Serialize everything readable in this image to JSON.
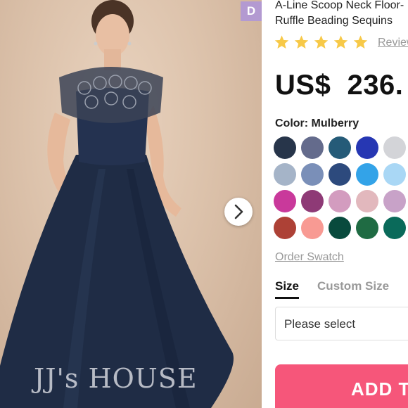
{
  "badge": {
    "letter": "D",
    "color": "#b39ad1"
  },
  "photo": {
    "watermark": "JJ's HOUSE",
    "next_icon": "chevron-right-icon"
  },
  "product": {
    "title_line1": "A-Line Scoop Neck Floor-",
    "title_line2": "Ruffle Beading Sequins",
    "rating_stars": 5,
    "star_color": "#f7c948",
    "reviews_label": "Review",
    "price": "US$  236."
  },
  "color": {
    "label": "Color: Mulberry",
    "swatches": [
      "#27354a",
      "#646b8c",
      "#255b78",
      "#2637b3",
      "#d3d4d8",
      "#a5b4c8",
      "#7a8fb8",
      "#2d4a7d",
      "#33a3e8",
      "#a9d7f5",
      "#c9399b",
      "#8e3a76",
      "#d39cbf",
      "#e2b8bd",
      "#c8a2c8",
      "#ad4136",
      "#f89a93",
      "#084a3d",
      "#1f6b43",
      "#0a6a5a"
    ],
    "order_swatch": "Order Swatch"
  },
  "size": {
    "tab_size": "Size",
    "tab_custom": "Custom Size",
    "select_placeholder": "Please select"
  },
  "cart": {
    "add_label": "ADD T",
    "button_color": "#f6567a"
  }
}
